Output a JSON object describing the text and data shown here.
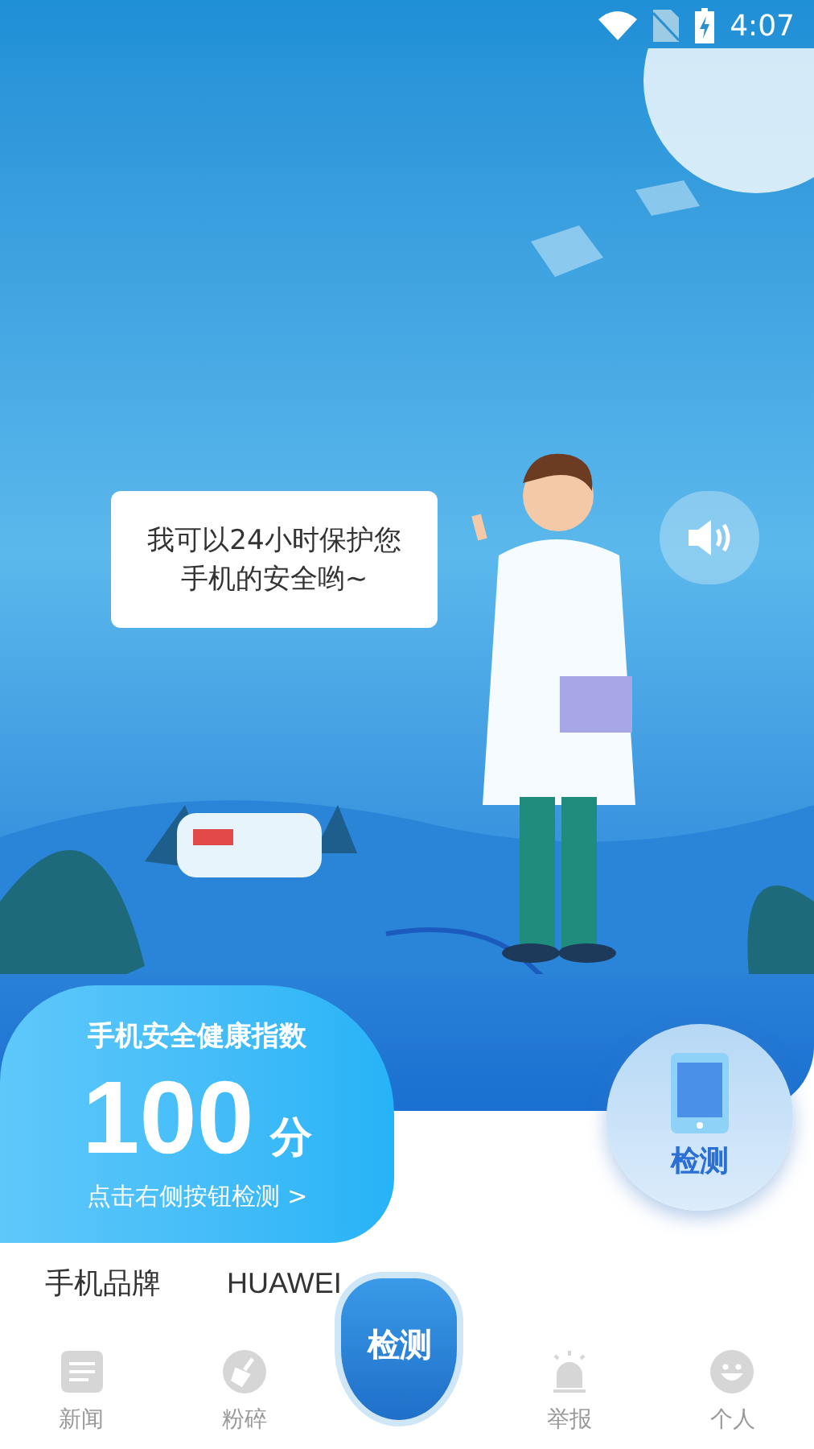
{
  "status_bar": {
    "time": "4:07"
  },
  "speech_bubble": {
    "lines": [
      "我可以24小时保护您",
      "手机的安全哟~"
    ]
  },
  "score_panel": {
    "title": "手机安全健康指数",
    "score": "100",
    "unit": "分",
    "hint": "点击右侧按钮检测 >"
  },
  "detect_button": {
    "label": "检测"
  },
  "device_info": [
    {
      "label": "手机品牌",
      "value": "HUAWEI"
    }
  ],
  "tab_bar": [
    {
      "label": "新闻",
      "kind": "news"
    },
    {
      "label": "粉碎",
      "kind": "shred"
    },
    {
      "label": "检测",
      "kind": "center"
    },
    {
      "label": "举报",
      "kind": "report"
    },
    {
      "label": "个人",
      "kind": "profile"
    }
  ]
}
